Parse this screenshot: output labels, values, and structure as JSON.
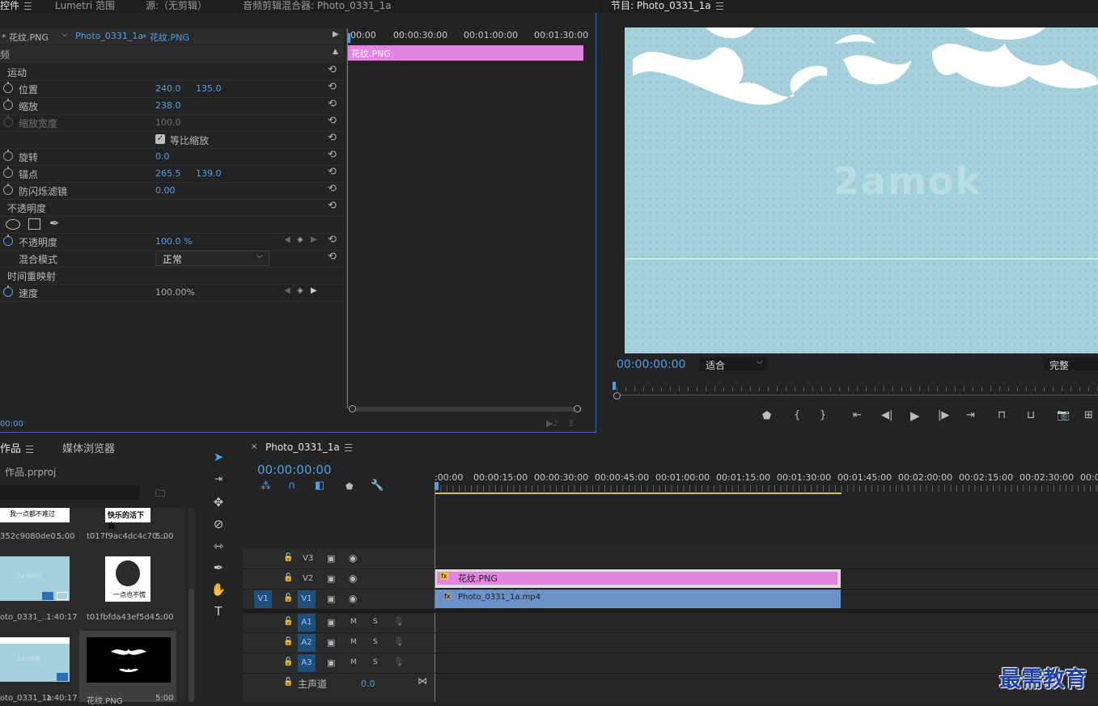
{
  "effect_controls": {
    "tabs": [
      "控件",
      "Lumetri 范围",
      "源:（无剪辑）",
      "音频剪辑混合器: Photo_0331_1a"
    ],
    "source_clip": "* 花纹.PNG",
    "sequence_clip": "Photo_0331_1a",
    "sequence_clip_sel": "* 花纹.PNG",
    "ruler": [
      "00:00",
      "00:00:30:00",
      "00:01:00:00",
      "00:01:30:00"
    ],
    "clip_bar_label": "花纹.PNG",
    "section_label": "频",
    "motion": "运动",
    "position": {
      "label": "位置",
      "x": "240.0",
      "y": "135.0"
    },
    "scale": {
      "label": "缩放",
      "value": "238.0"
    },
    "scale_width": {
      "label": "缩放宽度",
      "value": "100.0"
    },
    "uniform_scale": "等比缩放",
    "rotation": {
      "label": "旋转",
      "value": "0.0"
    },
    "anchor": {
      "label": "锚点",
      "x": "265.5",
      "y": "139.0"
    },
    "antiflicker": {
      "label": "防闪烁滤镜",
      "value": "0.00"
    },
    "opacity_section": "不透明度",
    "opacity": {
      "label": "不透明度",
      "value": "100.0 %"
    },
    "blend": {
      "label": "混合模式",
      "value": "正常"
    },
    "time_remap": "时间重映射",
    "speed": {
      "label": "速度",
      "value": "100.00%"
    },
    "timecode": "00:00"
  },
  "program": {
    "title": "节目: Photo_0331_1a",
    "watermark": "2amok",
    "timecode": "00:00:00:00",
    "fit": "适合",
    "quality": "完整"
  },
  "project": {
    "tabs": [
      "作品",
      "媒体浏览器"
    ],
    "file": "作品.prproj",
    "items": [
      {
        "caption": "我一点都不难过",
        "name": "352c9080de0...",
        "dur": "5:00"
      },
      {
        "caption": "快乐的活下去",
        "name": "t017f9ac4dc4c70...",
        "dur": "5:00"
      },
      {
        "caption": "2amok",
        "name": "oto_0331_...",
        "dur": "1:40:17"
      },
      {
        "caption": "一点也不慌",
        "name": "t01fbfda43ef5d4...",
        "dur": "5:00"
      },
      {
        "caption": "2amok",
        "name": "oto_0331_1a",
        "dur": "1:40:17"
      },
      {
        "caption": "",
        "name": "花纹.PNG",
        "dur": "5:00"
      }
    ]
  },
  "timeline": {
    "tab": "Photo_0331_1a",
    "timecode": "00:00:00:00",
    "ruler": [
      ":00:00",
      "00:00:15:00",
      "00:00:30:00",
      "00:00:45:00",
      "00:01:00:00",
      "00:01:15:00",
      "00:01:30:00",
      "00:01:45:00",
      "00:02:00:00",
      "00:02:15:00",
      "00:02:30:00",
      "00:0"
    ],
    "tracks": {
      "v3": "V3",
      "v2": "V2",
      "v1": "V1",
      "v1_src": "V1",
      "a1": "A1",
      "a2": "A2",
      "a3": "A3",
      "m": "M",
      "s": "S",
      "master": "主声道",
      "master_val": "0.0"
    },
    "clip_png": "花纹.PNG",
    "clip_mp4": "Photo_0331_1a.mp4",
    "fx": "fx"
  },
  "brand": "最需教育"
}
